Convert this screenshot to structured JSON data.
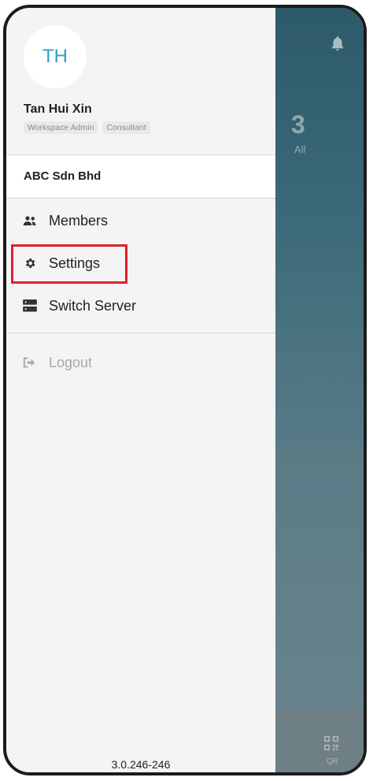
{
  "background": {
    "count": "3",
    "count_label": "All",
    "qr_label": "QR"
  },
  "profile": {
    "initials": "TH",
    "name": "Tan Hui Xin",
    "roles": [
      "Workspace Admin",
      "Consultant"
    ]
  },
  "company": "ABC Sdn Bhd",
  "menu": {
    "members": "Members",
    "settings": "Settings",
    "switch_server": "Switch Server",
    "logout": "Logout"
  },
  "version": "3.0.246-246",
  "colors": {
    "accent": "#2f9fcf",
    "highlight": "#e0202b"
  }
}
